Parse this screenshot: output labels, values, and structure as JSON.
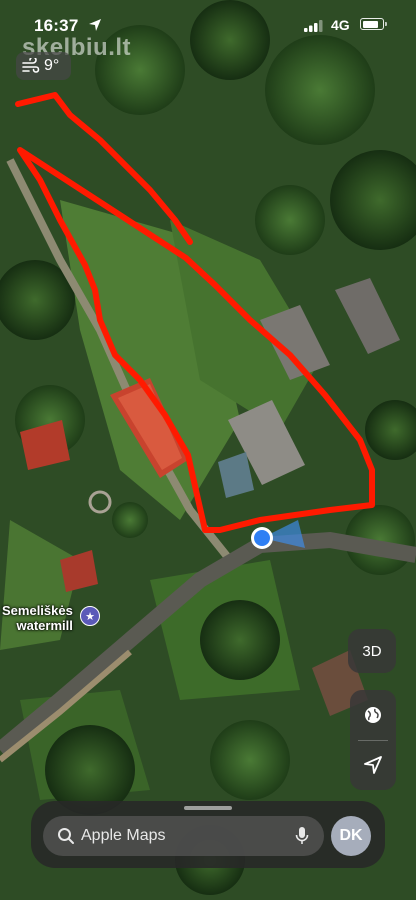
{
  "status_bar": {
    "time": "16:37",
    "network": "4G",
    "battery_level": 0.85
  },
  "watermark": "skelbiu.lt",
  "weather": {
    "temperature": "9°",
    "icon": "wind-icon"
  },
  "map": {
    "poi_label_line1": "Semeliškės",
    "poi_label_line2": "watermill",
    "poi_icon": "star-icon",
    "user_location": "blue-dot-with-heading",
    "annotation_color": "#ff1a00"
  },
  "controls": {
    "view_3d": "3D",
    "map_mode_icon": "globe-icon",
    "locate_icon": "location-arrow-icon"
  },
  "search": {
    "placeholder": "Apple Maps",
    "mic_icon": "microphone-icon"
  },
  "profile": {
    "initials": "DK"
  }
}
